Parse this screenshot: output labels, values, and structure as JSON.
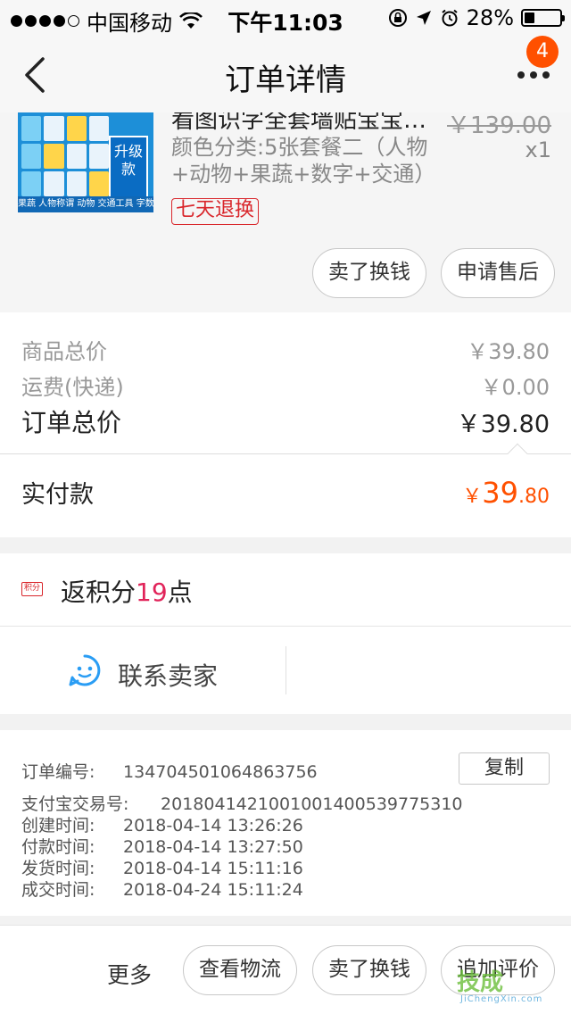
{
  "status": {
    "carrier": "中国移动",
    "time": "下午11:03",
    "battery": "28%",
    "battery_level": 0.28
  },
  "nav": {
    "title": "订单详情",
    "badge": "4"
  },
  "product": {
    "image_badge": "升级款",
    "image_caption": "果蔬 人物称谓 动物 交通工具 字数字",
    "name": "看图识字全套墙贴宝宝启蒙",
    "orig_price": "￥139.00",
    "spec": "颜色分类:5张套餐二（人物+动物+果蔬+数字+交通）",
    "qty": "x1",
    "tag": "七天退换",
    "btn_sell": "卖了换钱",
    "btn_aftersale": "申请售后"
  },
  "totals": {
    "goods_label": "商品总价",
    "goods_val": "￥39.80",
    "shipping_label": "运费(快递)",
    "shipping_val": "￥0.00",
    "order_label": "订单总价",
    "order_val": "￥39.80",
    "paid_label": "实付款",
    "paid_currency": "￥",
    "paid_int": "39",
    "paid_dec": ".80"
  },
  "points": {
    "icon_text": "积分",
    "prefix": "返积分",
    "num": "19",
    "suffix": "点"
  },
  "contact": {
    "label": "联系卖家"
  },
  "info": {
    "order_no_label": "订单编号:",
    "order_no": "134704501064863756",
    "copy": "复制",
    "alipay_label": "支付宝交易号:",
    "alipay_no": "2018041421001001400539775310",
    "created_label": "创建时间:",
    "created": "2018-04-14 13:26:26",
    "paid_label": "付款时间:",
    "paid": "2018-04-14 13:27:50",
    "shipped_label": "发货时间:",
    "shipped": "2018-04-14 15:11:16",
    "done_label": "成交时间:",
    "done": "2018-04-24 15:11:24"
  },
  "bottom": {
    "more": "更多",
    "logistics": "查看物流",
    "sell": "卖了换钱",
    "review": "追加评价"
  },
  "watermark": {
    "big": "技成",
    "small": "JiChengXin.com"
  },
  "colors": {
    "accent": "#ff5000",
    "tag_red": "#d9262b",
    "points_pink": "#e1245a"
  }
}
